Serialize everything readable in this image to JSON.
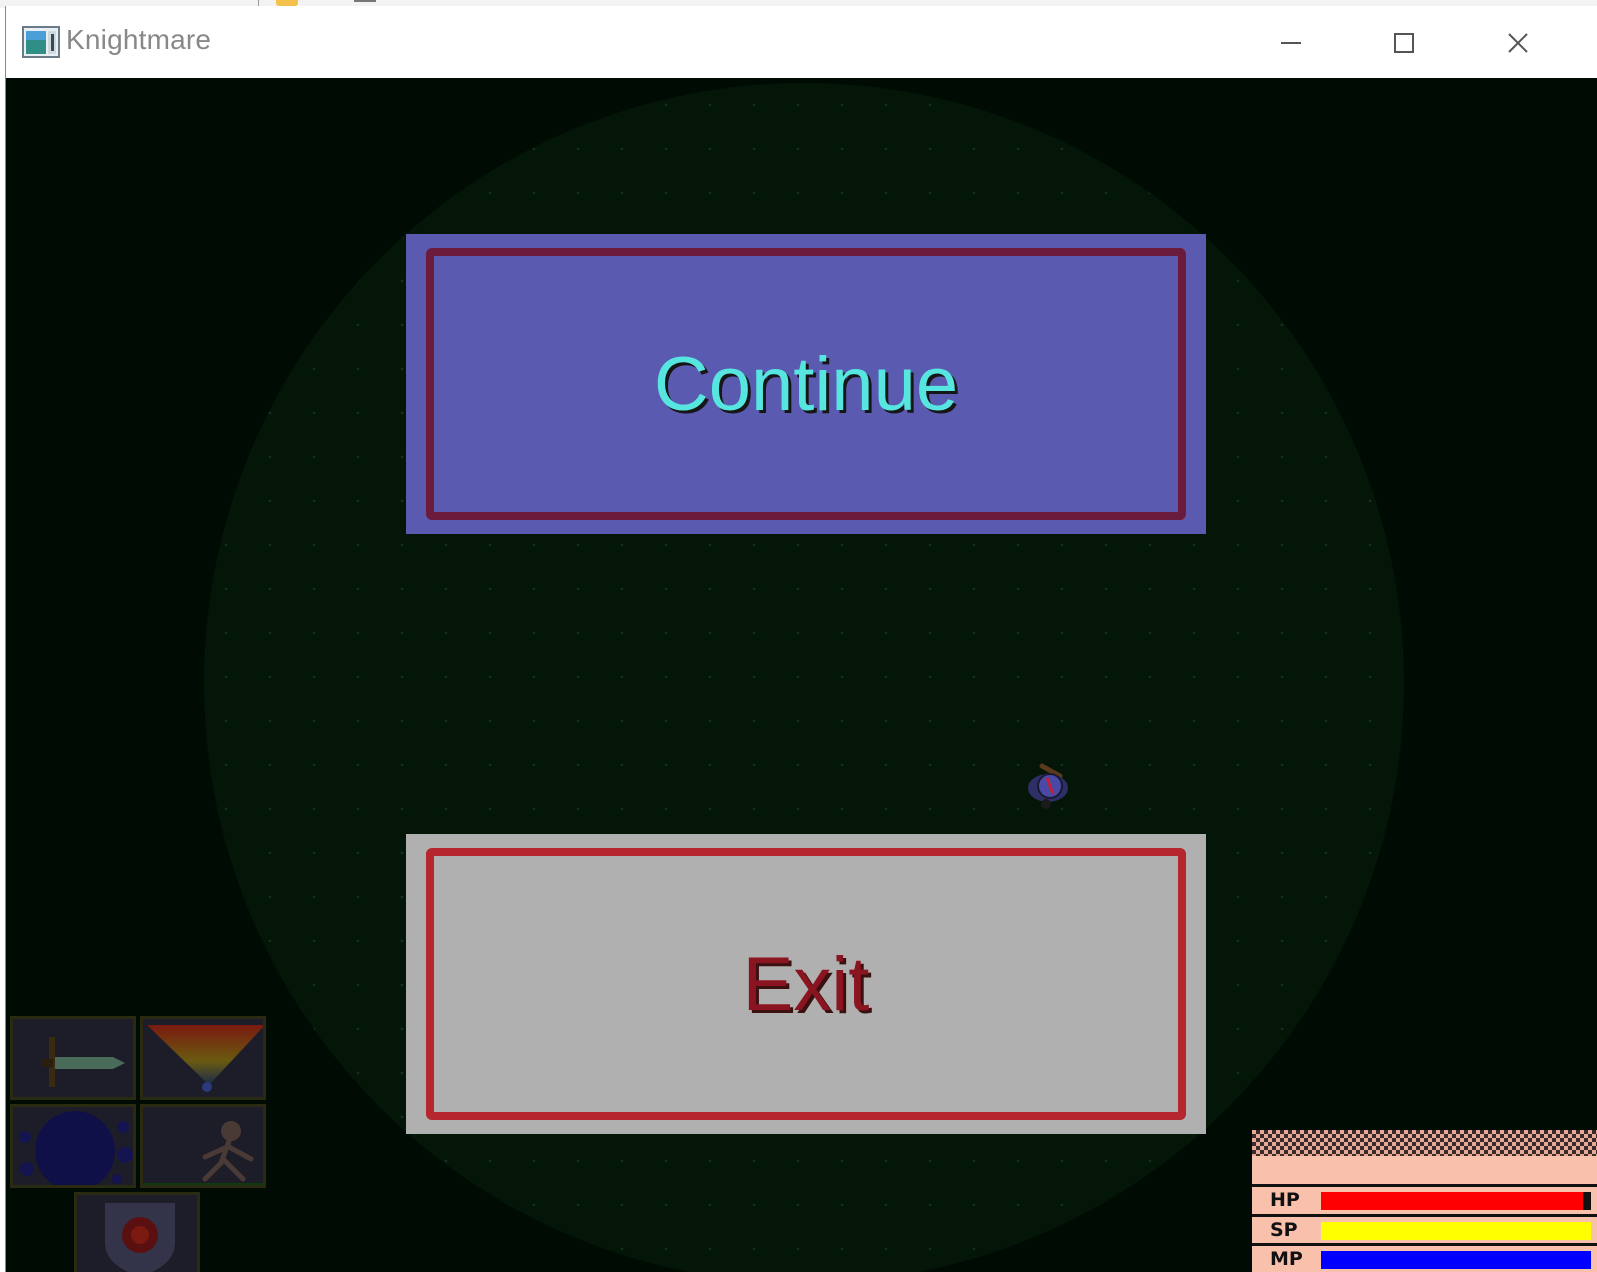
{
  "window": {
    "title": "Knightmare",
    "icons": {
      "app": "app-window-icon",
      "minimize": "minimize-icon",
      "maximize": "maximize-icon",
      "close": "close-icon"
    }
  },
  "menu": {
    "continue_label": "Continue",
    "exit_label": "Exit"
  },
  "colors": {
    "continue_bg": "#5a5ab0",
    "continue_text": "#57e6df",
    "exit_bg": "#b0b0b0",
    "exit_text": "#8a1420",
    "hp": "#ff0000",
    "sp": "#ffff00",
    "mp": "#0000ff"
  },
  "inventory": {
    "slots": [
      {
        "icon": "sword-icon"
      },
      {
        "icon": "torch-light-icon"
      },
      {
        "icon": "orb-spell-icon"
      },
      {
        "icon": "figure-summon-icon"
      },
      {
        "icon": "shield-icon"
      }
    ]
  },
  "stats": {
    "hp": {
      "label": "HP",
      "fraction": 0.97
    },
    "sp": {
      "label": "SP",
      "fraction": 1.0
    },
    "mp": {
      "label": "MP",
      "fraction": 1.0
    }
  }
}
